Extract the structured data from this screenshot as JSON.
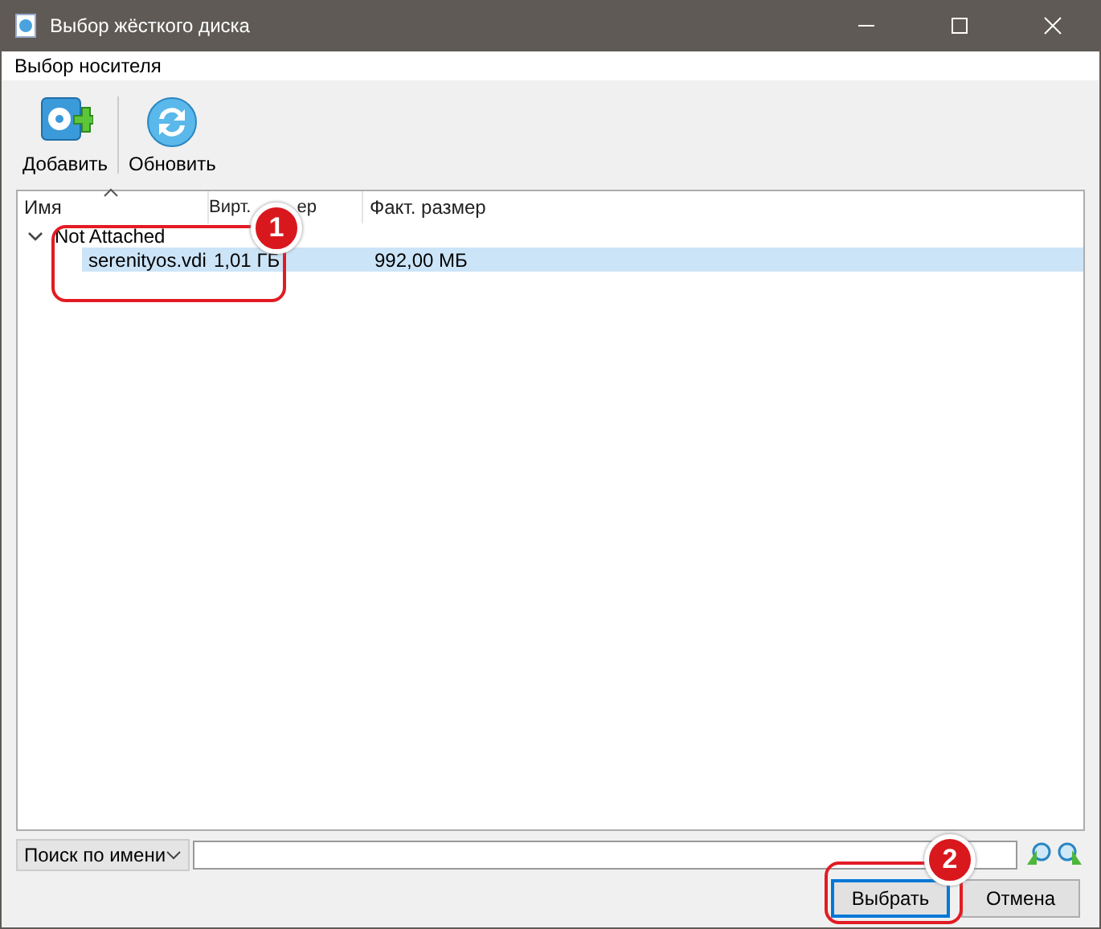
{
  "window": {
    "title": "Выбор жёсткого диска"
  },
  "menu": [
    "Выбор носителя"
  ],
  "toolbar": [
    {
      "kind": "add",
      "label": "Добавить"
    },
    {
      "kind": "refresh",
      "label": "Обновить"
    }
  ],
  "table": {
    "columns": [
      {
        "label": "Имя"
      },
      {
        "label": "Вирт.",
        "label_end": "ер"
      },
      {
        "label": "Факт. размер"
      }
    ],
    "groups": [
      {
        "name": "Not Attached",
        "expanded": true,
        "children": [
          {
            "name": "serenityos.vdi",
            "virtual": "1,01 ГБ",
            "actual": "992,00 МБ",
            "selected": true
          }
        ]
      }
    ]
  },
  "search": {
    "mode": "Поиск по имени"
  },
  "buttons": [
    {
      "label": "Выбрать",
      "default": true
    },
    {
      "label": "Отмена",
      "default": false
    }
  ],
  "annotations": [
    {
      "number": "1",
      "kind": "row"
    },
    {
      "number": "2",
      "kind": "button"
    }
  ]
}
